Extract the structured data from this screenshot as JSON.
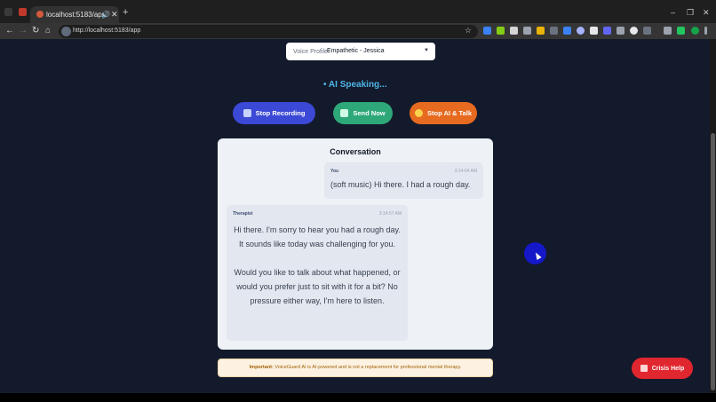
{
  "browser": {
    "tab_title": "localhost:5183/app",
    "url": "http://localhost:5183/app"
  },
  "voice_profile": {
    "label": "Voice Profile:",
    "value": "Empathetic - Jessica"
  },
  "status": "AI Speaking...",
  "buttons": {
    "stop_recording": "Stop Recording",
    "send_now": "Send Now",
    "stop_ai_talk": "Stop AI & Talk"
  },
  "conversation": {
    "title": "Conversation",
    "messages": [
      {
        "sender": "You",
        "time": "3:14:54 AM",
        "text": "(soft music) Hi there. I had a rough day."
      },
      {
        "sender": "Therapist",
        "time": "3:14:57 AM",
        "text": "Hi there. I'm sorry to hear you had a rough day. It sounds like today was challenging for you.\n\nWould you like to talk about what happened, or would you prefer just to sit with it for a bit? No pressure either way, I'm here to listen."
      }
    ]
  },
  "disclaimer": {
    "bold": "Important:",
    "text": " VoiceGuard AI is AI-powered and is not a replacement for professional mental therapy."
  },
  "crisis_button": "Crisis Help",
  "colors": {
    "background": "#131a2b",
    "status_text": "#4fb6e8",
    "stop_recording": "#3b49d6",
    "send_now": "#2ea879",
    "stop_ai": "#e66a20",
    "crisis": "#e0262f"
  }
}
